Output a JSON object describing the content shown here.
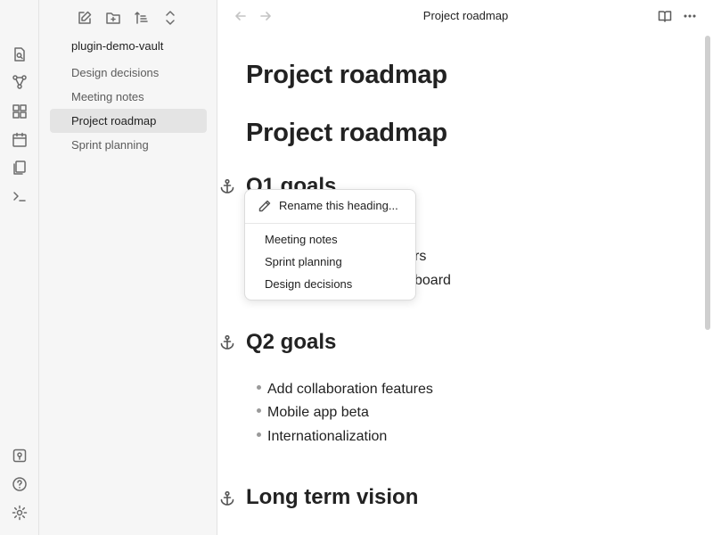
{
  "sidebar": {
    "vault_name": "plugin-demo-vault",
    "files": [
      {
        "label": "Design decisions",
        "active": false
      },
      {
        "label": "Meeting notes",
        "active": false
      },
      {
        "label": "Project roadmap",
        "active": true
      },
      {
        "label": "Sprint planning",
        "active": false
      }
    ]
  },
  "editor": {
    "view_title": "Project roadmap",
    "h1_first": "Project roadmap",
    "h1_second": "Project roadmap",
    "q1": {
      "heading": "Q1 goals",
      "partial_line_1": "rs",
      "partial_line_2": "board"
    },
    "q2": {
      "heading": "Q2 goals",
      "items": [
        "Add collaboration features",
        "Mobile app beta",
        "Internationalization"
      ]
    },
    "long_term": {
      "heading": "Long term vision"
    }
  },
  "context_menu": {
    "rename_label": "Rename this heading...",
    "items": [
      "Meeting notes",
      "Sprint planning",
      "Design decisions"
    ]
  },
  "icons": {
    "ribbon_top": [
      "file-search-icon",
      "graph-icon",
      "canvas-icon",
      "calendar-icon",
      "copy-icon",
      "terminal-icon"
    ],
    "ribbon_bottom": [
      "vault-icon",
      "help-icon",
      "settings-icon"
    ],
    "nav_toolbar": [
      "new-note-icon",
      "new-folder-icon",
      "sort-icon",
      "collapse-icon"
    ],
    "title_actions": [
      "reading-view-icon",
      "more-options-icon"
    ]
  },
  "colors": {
    "sidebar_bg": "#f6f6f6",
    "active_file_bg": "#e4e4e4",
    "text": "#222222",
    "muted_text": "#5c5c5c"
  }
}
